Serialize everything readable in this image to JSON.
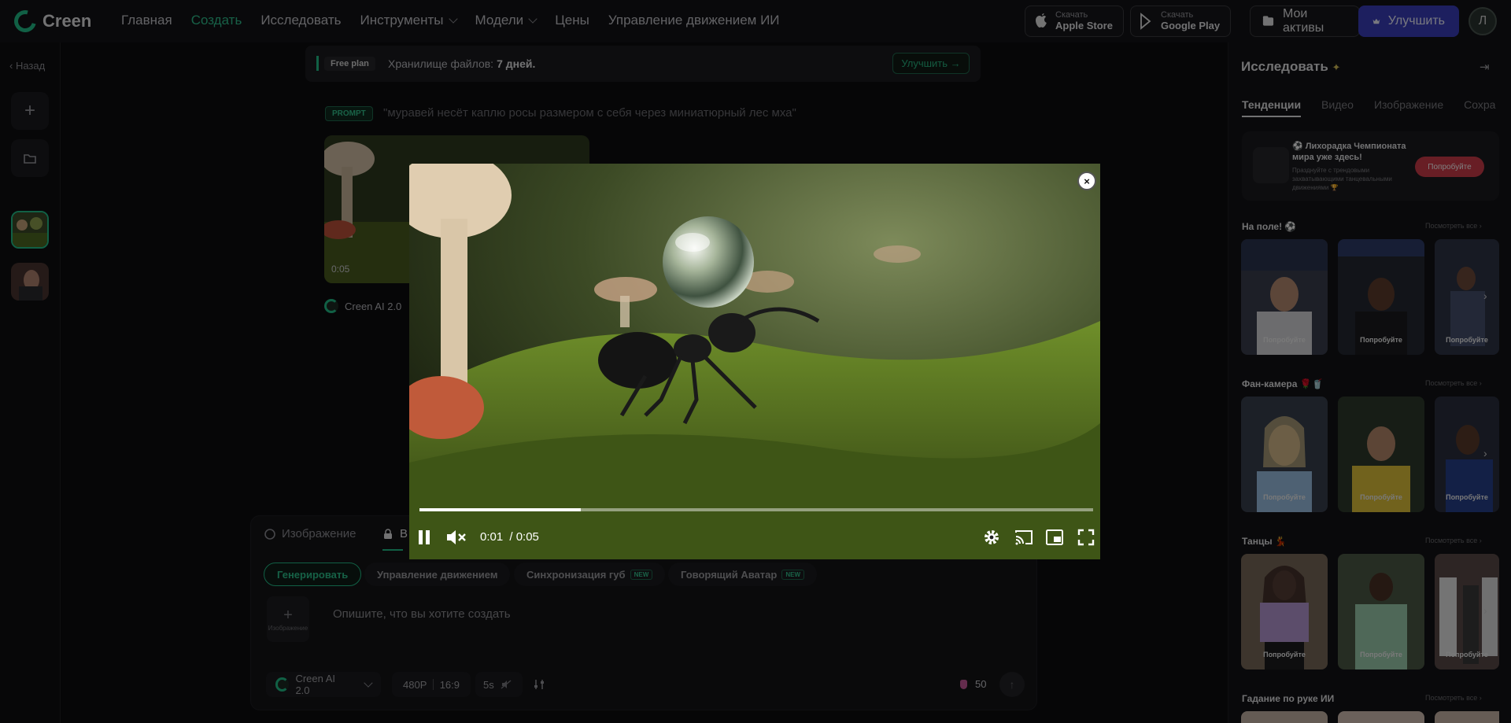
{
  "brand": {
    "name": "Creen",
    "accent": "#22c08a"
  },
  "nav": {
    "items": [
      {
        "label": "Главная",
        "active": false,
        "dropdown": false
      },
      {
        "label": "Создать",
        "active": true,
        "dropdown": false
      },
      {
        "label": "Исследовать",
        "active": false,
        "dropdown": false
      },
      {
        "label": "Инструменты",
        "active": false,
        "dropdown": true
      },
      {
        "label": "Модели",
        "active": false,
        "dropdown": true
      },
      {
        "label": "Цены",
        "active": false,
        "dropdown": false
      },
      {
        "label": "Управление движением ИИ",
        "active": false,
        "dropdown": false
      }
    ]
  },
  "header_actions": {
    "apple": {
      "small": "Скачать",
      "big": "Apple Store",
      "icon": "apple-icon"
    },
    "google": {
      "small": "Скачать",
      "big": "Google Play",
      "icon": "google-play-icon"
    },
    "assets_label": "Мои активы",
    "upgrade_label": "Улучшить",
    "avatar_initial": "Л"
  },
  "left_rail": {
    "back_label": "Назад"
  },
  "banner": {
    "badge": "Free plan",
    "text": "Хранилище файлов:",
    "value": "7 дней.",
    "button": "Улучшить →"
  },
  "generation": {
    "prompt_tag": "PROMPT",
    "prompt": "\"муравей несёт каплю росы размером с себя через миниатюрный лес мха\"",
    "duration": "0:05",
    "model": "Creen AI 2.0"
  },
  "composer": {
    "tabs": [
      {
        "label": "Изображение"
      },
      {
        "label": "В"
      }
    ],
    "modes": [
      {
        "label": "Генерировать",
        "active": true,
        "new": false
      },
      {
        "label": "Управление движением",
        "active": false,
        "new": false
      },
      {
        "label": "Синхронизация губ",
        "active": false,
        "new": true
      },
      {
        "label": "Говорящий Аватар",
        "active": false,
        "new": true
      }
    ],
    "new_label": "NEW",
    "image_add_label": "Изображение",
    "placeholder": "Опишите, что вы хотите создать",
    "model": "Creen AI 2.0",
    "resolution": "480P",
    "aspect": "16:9",
    "duration": "5s",
    "credits": "50"
  },
  "player": {
    "current_time": "0:01",
    "separator": "/ 0:05",
    "progress": 0.24
  },
  "explore": {
    "title": "Исследовать",
    "tabs": [
      {
        "label": "Тенденции",
        "active": true
      },
      {
        "label": "Видео",
        "active": false
      },
      {
        "label": "Изображение",
        "active": false
      },
      {
        "label": "Сохра",
        "active": false
      }
    ],
    "promo": {
      "title": "⚽ Лихорадка Чемпионата мира уже здесь!",
      "subtitle": "Празднуйте с трендовыми захватывающими танцевальными движениями 🏆",
      "button": "Попробуйте"
    },
    "see_all": "Посмотреть все ›",
    "try_label": "Попробуйте",
    "sections": [
      {
        "title": "На поле! ⚽"
      },
      {
        "title": "Фан-камера 🌹🥤"
      },
      {
        "title": "Танцы 💃"
      },
      {
        "title": "Гадание по руке ИИ"
      }
    ]
  }
}
